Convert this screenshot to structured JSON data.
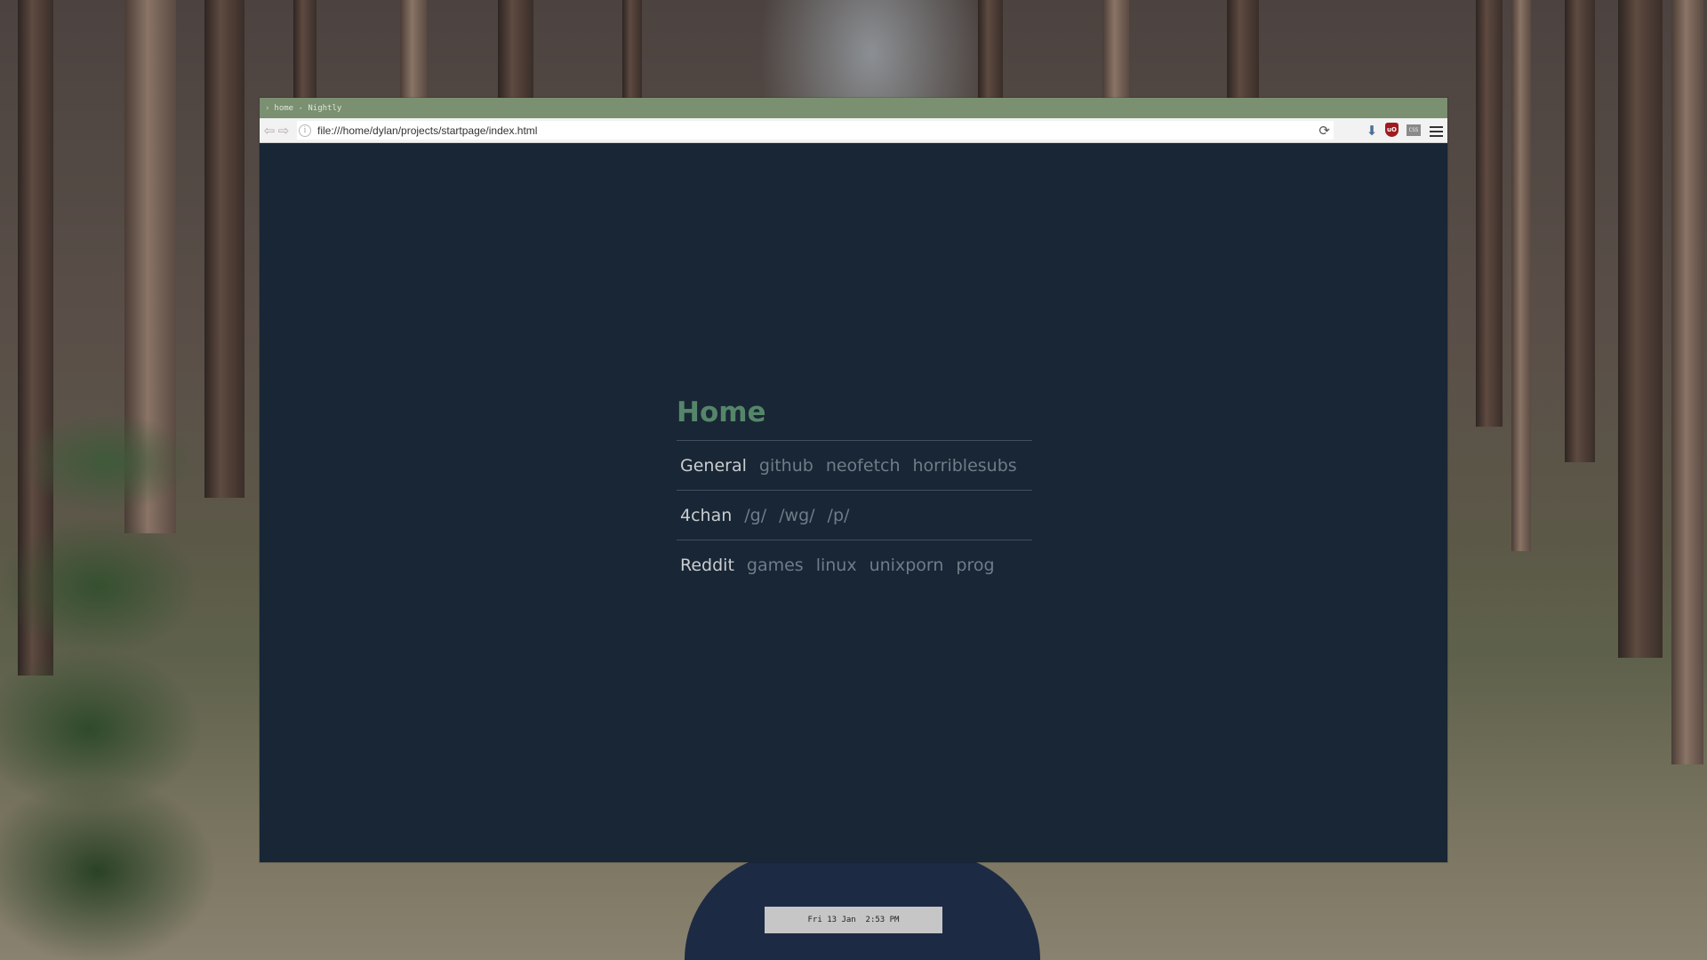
{
  "window": {
    "title": "home - Nightly",
    "title_chevron": "›"
  },
  "navbar": {
    "back_icon": "⇦",
    "forward_icon": "⇨",
    "info_icon": "i",
    "url": "file:///home/dylan/projects/startpage/index.html",
    "reload_icon": "⟳",
    "download_icon": "⬇",
    "ublock_label": "uO",
    "css_label": "CSS"
  },
  "startpage": {
    "title": "Home",
    "sections": [
      {
        "category": "General",
        "links": [
          "github",
          "neofetch",
          "horriblesubs"
        ]
      },
      {
        "category": "4chan",
        "links": [
          "/g/",
          "/wg/",
          "/p/"
        ]
      },
      {
        "category": "Reddit",
        "links": [
          "games",
          "linux",
          "unixporn",
          "prog"
        ]
      }
    ]
  },
  "clock": {
    "text": "Fri 13 Jan  2:53 PM"
  },
  "colors": {
    "titlebar": "#7a9070",
    "page_bg": "#182635",
    "heading": "#55866a",
    "category": "#c9cdd0",
    "link": "#6f7d88",
    "divider": "#41505d"
  }
}
